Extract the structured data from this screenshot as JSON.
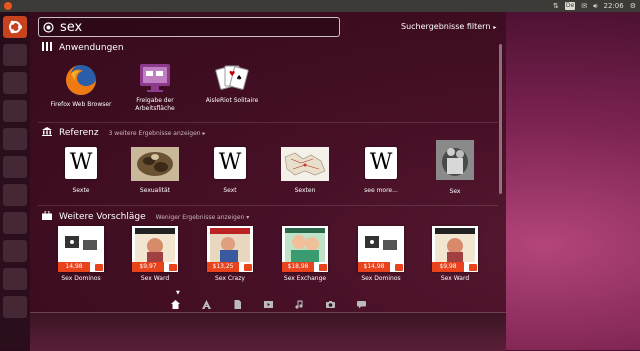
{
  "topbar": {
    "keyboard_layout": "De",
    "time": "22:06"
  },
  "search": {
    "query": "sex",
    "filter_label": "Suchergebnisse filtern",
    "filter_arrow": "▸"
  },
  "categories": [
    {
      "title": "Anwendungen",
      "items": [
        {
          "label": "Firefox Web Browser",
          "icon": "firefox-icon"
        },
        {
          "label": "Freigabe der Arbeitsfläche",
          "icon": "desktop-sharing-icon"
        },
        {
          "label": "AisleRiot Solitaire",
          "icon": "solitaire-cards-icon"
        }
      ]
    },
    {
      "title": "Referenz",
      "more": "3 weitere Ergebnisse anzeigen",
      "more_arrow": "▸",
      "items": [
        {
          "label": "Sexte",
          "icon": "wikipedia-icon"
        },
        {
          "label": "Sexualität",
          "icon": "sculpture-photo"
        },
        {
          "label": "Sext",
          "icon": "wikipedia-icon"
        },
        {
          "label": "Sexten",
          "icon": "map-photo"
        },
        {
          "label": "see more...",
          "icon": "wikipedia-icon"
        },
        {
          "label": "Sex",
          "icon": "statue-photo"
        }
      ]
    },
    {
      "title": "Weitere Vorschläge",
      "more": "Weniger Ergebnisse anzeigen",
      "more_arrow": "▾",
      "items": [
        {
          "label": "Sex Dominos",
          "price": "14,98"
        },
        {
          "label": "Sex Ward",
          "price": "$9,97"
        },
        {
          "label": "Sex Crazy",
          "price": "$13,25"
        },
        {
          "label": "Sex Exchange",
          "price": "$18,98"
        },
        {
          "label": "Sex Dominos",
          "price": "$14,98"
        },
        {
          "label": "Sex Ward",
          "price": "$9,98"
        }
      ]
    }
  ],
  "lenses": [
    "home-lens-icon",
    "applications-lens-icon",
    "files-lens-icon",
    "video-lens-icon",
    "music-lens-icon",
    "photos-lens-icon",
    "social-lens-icon"
  ],
  "colors": {
    "accent": "#e9541f",
    "price_tag": "#e8431c",
    "panel": "#3c3b37"
  }
}
